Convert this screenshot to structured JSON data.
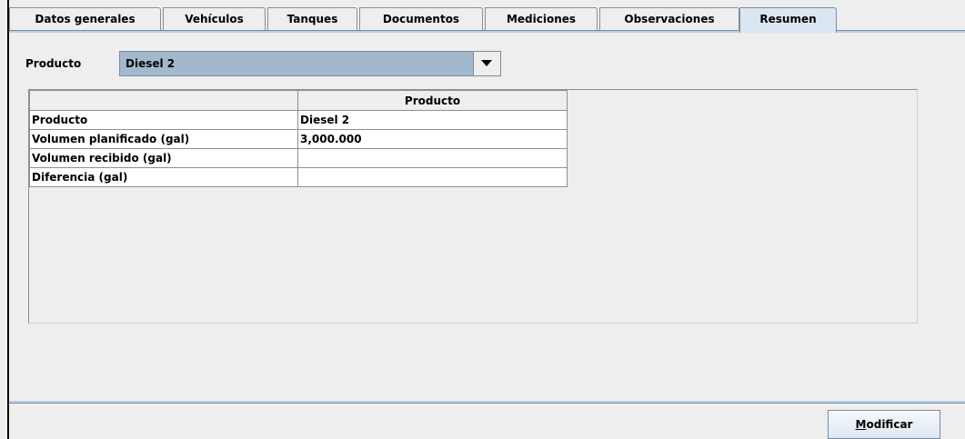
{
  "tabs": [
    {
      "label": "Datos generales",
      "selected": false
    },
    {
      "label": "Vehículos",
      "selected": false
    },
    {
      "label": "Tanques",
      "selected": false
    },
    {
      "label": "Documentos",
      "selected": false
    },
    {
      "label": "Mediciones",
      "selected": false
    },
    {
      "label": "Observaciones",
      "selected": false
    },
    {
      "label": "Resumen",
      "selected": true
    }
  ],
  "producto_filter": {
    "label": "Producto",
    "selected_value": "Diesel 2"
  },
  "summary_table": {
    "headers": [
      "",
      "Producto"
    ],
    "rows": [
      [
        "Producto",
        "Diesel 2"
      ],
      [
        "Volumen planificado (gal)",
        "3,000.000"
      ],
      [
        "Volumen recibido (gal)",
        ""
      ],
      [
        "Diferencia (gal)",
        ""
      ]
    ]
  },
  "actions": {
    "modificar_mnemonic": "M",
    "modificar_rest": "odificar"
  },
  "colors": {
    "selected_tab": "#dbe6f3",
    "combo_selection": "#a3b8cc",
    "panel_background": "#eeeeee"
  }
}
